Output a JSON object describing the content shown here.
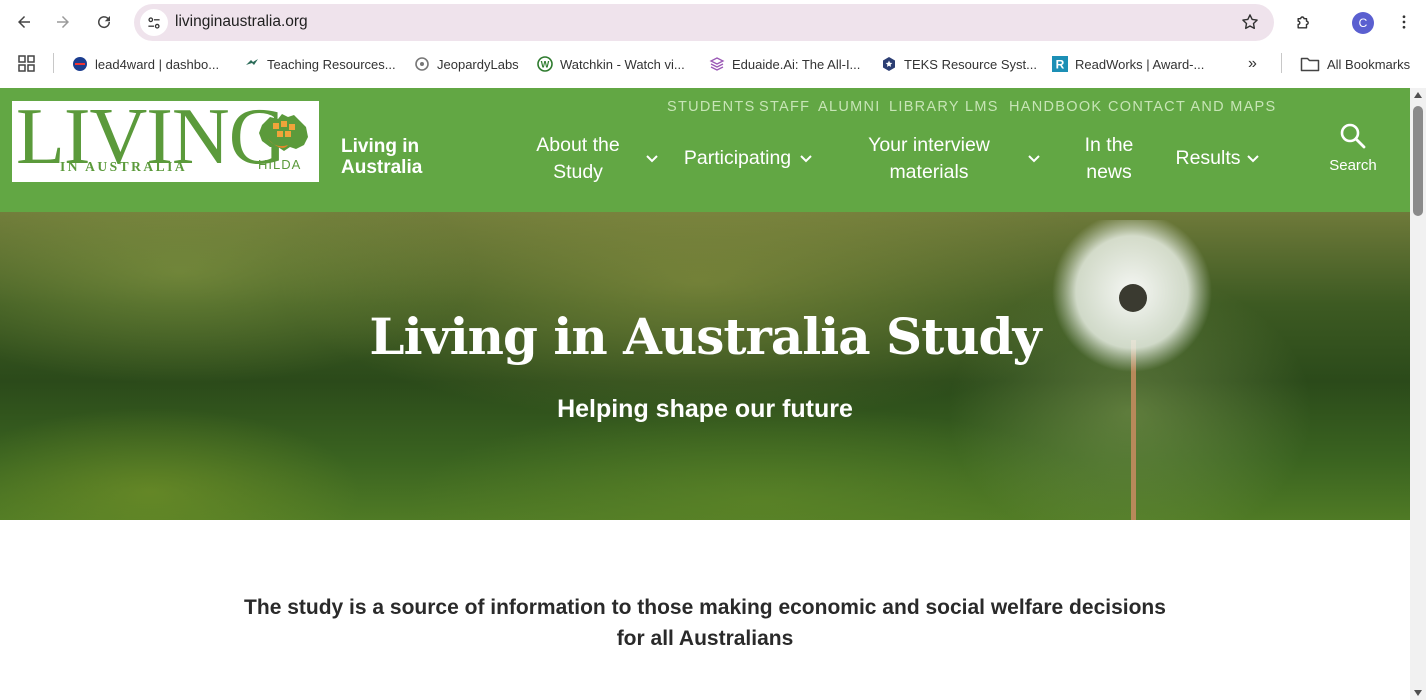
{
  "browser": {
    "url": "livinginaustralia.org",
    "avatar_letter": "C",
    "bookmarks": [
      {
        "label": "lead4ward | dashbo...",
        "icon": "lead4ward-icon"
      },
      {
        "label": "Teaching Resources...",
        "icon": "teaching-resources-icon"
      },
      {
        "label": "JeopardyLabs",
        "icon": "jeopardylabs-icon"
      },
      {
        "label": "Watchkin - Watch vi...",
        "icon": "watchkin-icon"
      },
      {
        "label": "Eduaide.Ai: The All-I...",
        "icon": "eduaide-icon"
      },
      {
        "label": "TEKS Resource Syst...",
        "icon": "teks-icon"
      },
      {
        "label": "ReadWorks | Award-...",
        "icon": "readworks-icon"
      }
    ],
    "overflow_label": "»",
    "all_bookmarks_label": "All Bookmarks"
  },
  "site": {
    "logo": {
      "word": "LIVING",
      "tagline": "IN AUSTRALIA",
      "hilda": "HILDA"
    },
    "name": "Living in Australia",
    "utility_nav": [
      "STUDENTS",
      "STAFF",
      "ALUMNI",
      "LIBRARY",
      "LMS",
      "HANDBOOK",
      "CONTACT AND MAPS"
    ],
    "main_nav": {
      "about": "About the Study",
      "participating": "Participating",
      "interview": "Your interview materials",
      "news": "In the news",
      "results": "Results"
    },
    "search_label": "Search",
    "colors": {
      "header_green": "#62a744",
      "logo_green": "#5b9a3b"
    }
  },
  "hero": {
    "title": "Living in Australia Study",
    "subtitle": "Helping shape our future"
  },
  "intro": {
    "text": "The study is a source of information to those making economic and social welfare decisions for all Australians"
  }
}
